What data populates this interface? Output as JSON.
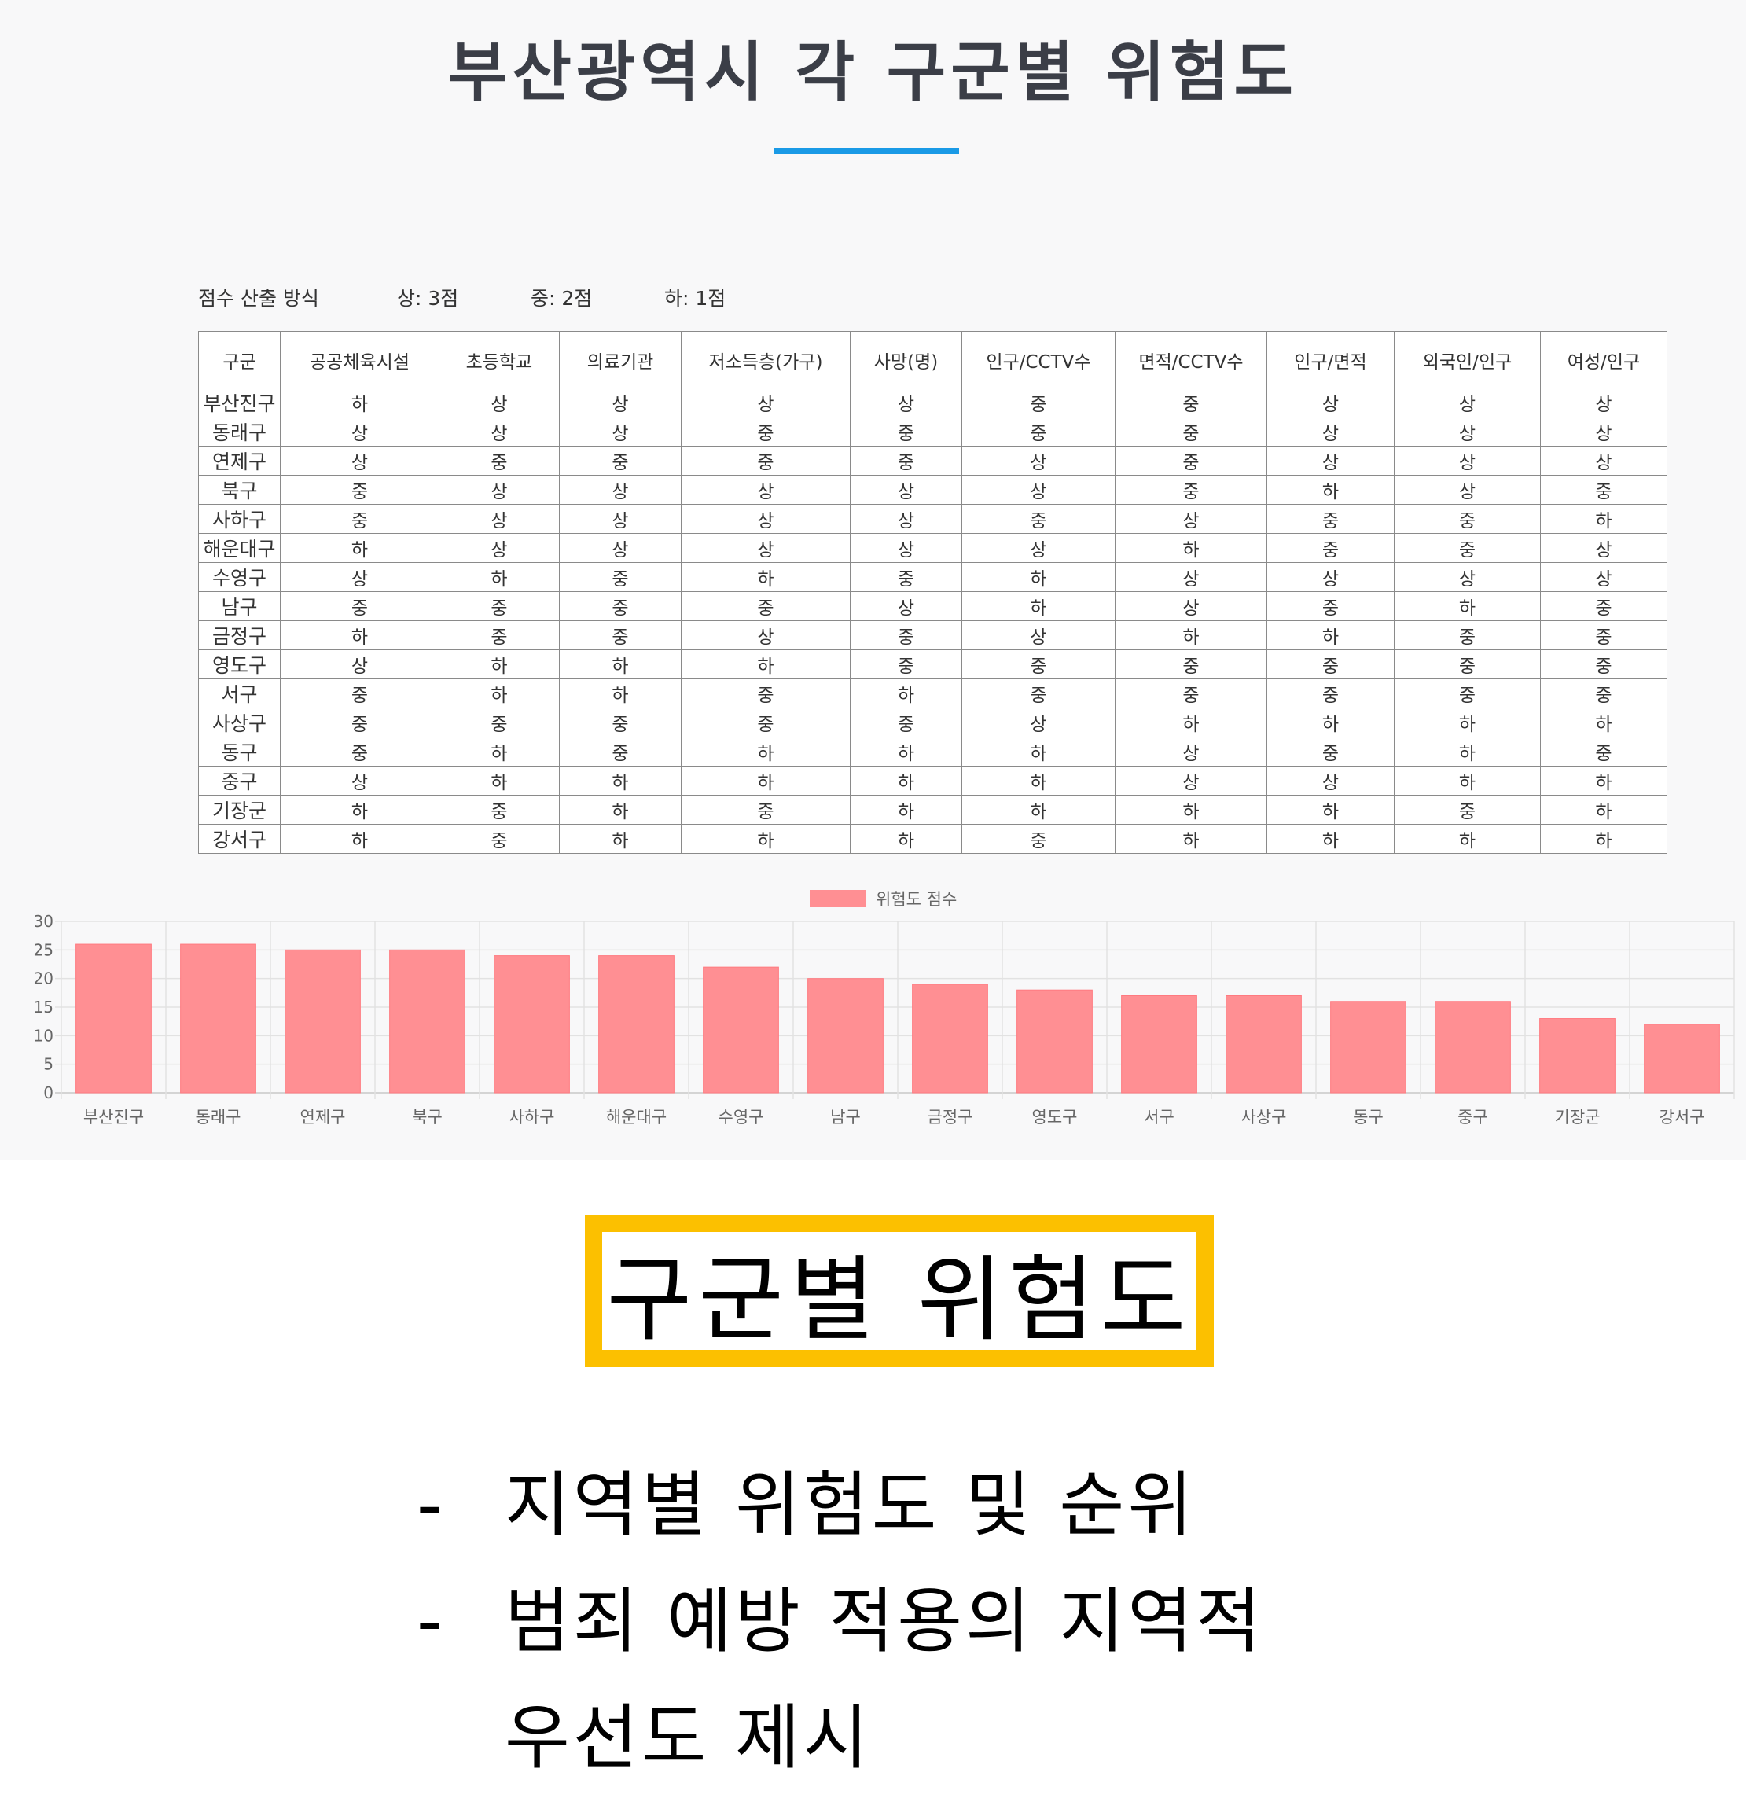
{
  "page": {
    "title": "부산광역시 각 구군별 위험도",
    "accent": "#1a9ae6"
  },
  "score_method": {
    "label": "점수 산출 방식",
    "high": "상: 3점",
    "mid": "중: 2점",
    "low": "하: 1점"
  },
  "table": {
    "headers": [
      "구군",
      "공공체육시설",
      "초등학교",
      "의료기관",
      "저소득층(가구)",
      "사망(명)",
      "인구/CCTV수",
      "면적/CCTV수",
      "인구/면적",
      "외국인/인구",
      "여성/인구"
    ],
    "rows": [
      [
        "부산진구",
        "하",
        "상",
        "상",
        "상",
        "상",
        "중",
        "중",
        "상",
        "상",
        "상"
      ],
      [
        "동래구",
        "상",
        "상",
        "상",
        "중",
        "중",
        "중",
        "중",
        "상",
        "상",
        "상"
      ],
      [
        "연제구",
        "상",
        "중",
        "중",
        "중",
        "중",
        "상",
        "중",
        "상",
        "상",
        "상"
      ],
      [
        "북구",
        "중",
        "상",
        "상",
        "상",
        "상",
        "상",
        "중",
        "하",
        "상",
        "중"
      ],
      [
        "사하구",
        "중",
        "상",
        "상",
        "상",
        "상",
        "중",
        "상",
        "중",
        "중",
        "하"
      ],
      [
        "해운대구",
        "하",
        "상",
        "상",
        "상",
        "상",
        "상",
        "하",
        "중",
        "중",
        "상"
      ],
      [
        "수영구",
        "상",
        "하",
        "중",
        "하",
        "중",
        "하",
        "상",
        "상",
        "상",
        "상"
      ],
      [
        "남구",
        "중",
        "중",
        "중",
        "중",
        "상",
        "하",
        "상",
        "중",
        "하",
        "중"
      ],
      [
        "금정구",
        "하",
        "중",
        "중",
        "상",
        "중",
        "상",
        "하",
        "하",
        "중",
        "중"
      ],
      [
        "영도구",
        "상",
        "하",
        "하",
        "하",
        "중",
        "중",
        "중",
        "중",
        "중",
        "중"
      ],
      [
        "서구",
        "중",
        "하",
        "하",
        "중",
        "하",
        "중",
        "중",
        "중",
        "중",
        "중"
      ],
      [
        "사상구",
        "중",
        "중",
        "중",
        "중",
        "중",
        "상",
        "하",
        "하",
        "하",
        "하"
      ],
      [
        "동구",
        "중",
        "하",
        "중",
        "하",
        "하",
        "하",
        "상",
        "중",
        "하",
        "중"
      ],
      [
        "중구",
        "상",
        "하",
        "하",
        "하",
        "하",
        "하",
        "상",
        "상",
        "하",
        "하"
      ],
      [
        "기장군",
        "하",
        "중",
        "하",
        "중",
        "하",
        "하",
        "하",
        "하",
        "중",
        "하"
      ],
      [
        "강서구",
        "하",
        "중",
        "하",
        "하",
        "하",
        "중",
        "하",
        "하",
        "하",
        "하"
      ]
    ]
  },
  "chart_data": {
    "type": "bar",
    "categories": [
      "부산진구",
      "동래구",
      "연제구",
      "북구",
      "사하구",
      "해운대구",
      "수영구",
      "남구",
      "금정구",
      "영도구",
      "서구",
      "사상구",
      "동구",
      "중구",
      "기장군",
      "강서구"
    ],
    "series": [
      {
        "name": "위험도 점수",
        "values": [
          26,
          26,
          25,
          25,
          24,
          24,
          22,
          20,
          19,
          18,
          17,
          17,
          16,
          16,
          13,
          12
        ]
      }
    ],
    "ylim": [
      0,
      30
    ],
    "yticks": [
      0,
      5,
      10,
      15,
      20,
      25,
      30
    ],
    "grid": true,
    "legend": "top-center",
    "bar_color": "#ff8f93"
  },
  "summary": {
    "box_title": "구군별 위험도",
    "box_border_color": "#fcc000",
    "bullets": [
      {
        "dash": "-",
        "text": "지역별 위험도 및 순위"
      },
      {
        "dash": "-",
        "text": "범죄 예방 적용의 지역적"
      },
      {
        "dash": "",
        "text": "우선도 제시"
      }
    ]
  }
}
